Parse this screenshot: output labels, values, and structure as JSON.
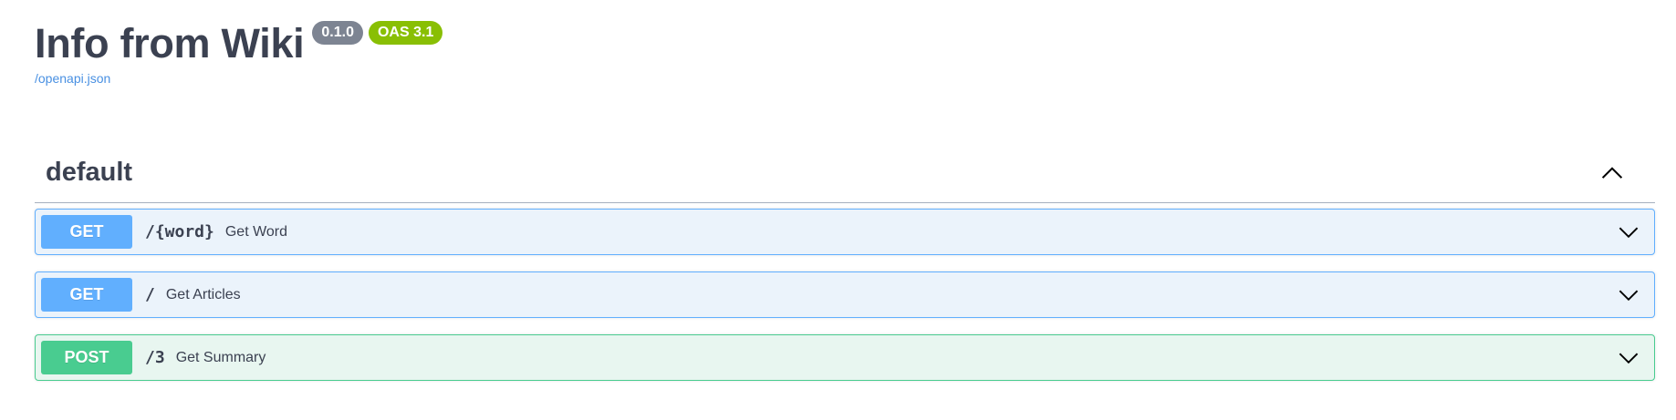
{
  "info": {
    "title": "Info from Wiki",
    "version_badge": "0.1.0",
    "oas_badge": "OAS 3.1",
    "spec_link": "/openapi.json"
  },
  "tag": {
    "name": "default",
    "toggle_icon": "chevron-up-icon"
  },
  "operations": [
    {
      "method": "GET",
      "path": "/{word}",
      "summary": "Get Word",
      "color": "#61affe",
      "toggle_icon": "chevron-down-icon"
    },
    {
      "method": "GET",
      "path": "/",
      "summary": "Get Articles",
      "color": "#61affe",
      "toggle_icon": "chevron-down-icon"
    },
    {
      "method": "POST",
      "path": "/3",
      "summary": "Get Summary",
      "color": "#49cc90",
      "toggle_icon": "chevron-down-icon"
    }
  ],
  "colors": {
    "text": "#3b4151",
    "link": "#4990e2",
    "get": "#61affe",
    "post": "#49cc90",
    "version_badge": "#7d8492",
    "oas_badge": "#89bf04"
  }
}
